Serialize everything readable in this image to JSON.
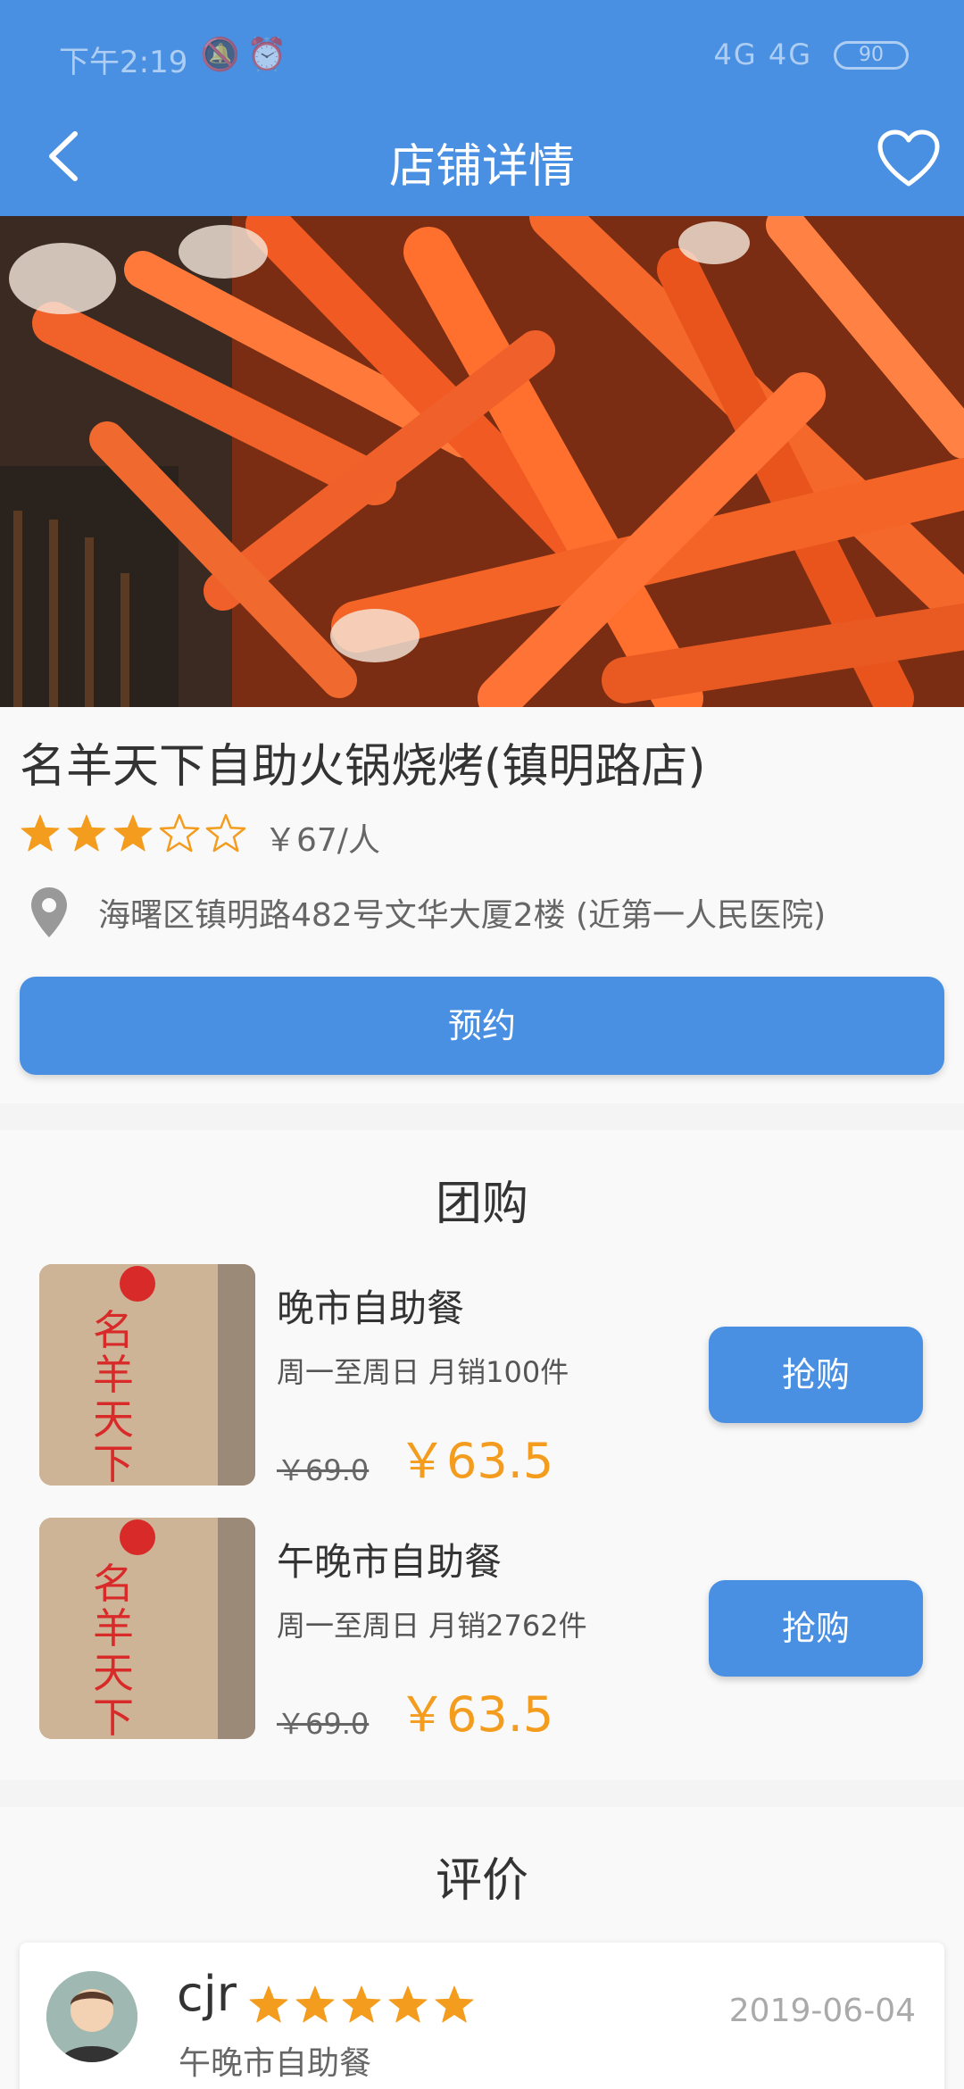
{
  "status_bar": {
    "time": "下午2:19",
    "network": "4G 4G",
    "battery": "90"
  },
  "nav": {
    "title": "店铺详情"
  },
  "shop": {
    "name": "名羊天下自助火锅烧烤(镇明路店)",
    "rating": 3,
    "rating_max": 5,
    "price_per_person": "￥67/人",
    "address": "海曙区镇明路482号文华大厦2楼 (近第一人民医院)",
    "book_label": "预约"
  },
  "group_buy": {
    "title": "团购",
    "deals": [
      {
        "name": "晚市自助餐",
        "subtitle": "周一至周日  月销100件",
        "old_price": "￥69.0",
        "price": "￥63.5",
        "buy_label": "抢购"
      },
      {
        "name": "午晚市自助餐",
        "subtitle": "周一至周日  月销2762件",
        "old_price": "￥69.0",
        "price": "￥63.5",
        "buy_label": "抢购"
      }
    ]
  },
  "reviews": {
    "title": "评价",
    "items": [
      {
        "user": "cjr",
        "rating": 5,
        "date": "2019-06-04",
        "deal": "午晚市自助餐"
      }
    ]
  },
  "colors": {
    "primary": "#4a90e2",
    "star": "#f39c1e",
    "price": "#f39c1e"
  }
}
